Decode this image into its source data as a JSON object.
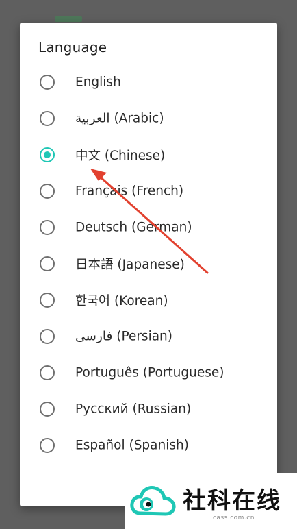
{
  "dialog": {
    "title": "Language",
    "selected_index": 2,
    "options": [
      {
        "label": "English"
      },
      {
        "label": "العربية (Arabic)"
      },
      {
        "label": "中文 (Chinese)"
      },
      {
        "label": "Français (French)"
      },
      {
        "label": "Deutsch (German)"
      },
      {
        "label": "日本語 (Japanese)"
      },
      {
        "label": "한국어 (Korean)"
      },
      {
        "label": "فارسی (Persian)"
      },
      {
        "label": "Português (Portuguese)"
      },
      {
        "label": "Русский (Russian)"
      },
      {
        "label": "Español (Spanish)"
      }
    ]
  },
  "watermark": {
    "text": "社科在线",
    "url": "cass.com.cn"
  },
  "colors": {
    "accent": "#1fc7b5",
    "annotation_arrow": "#e2412f",
    "scrim": "#5f5f5f"
  }
}
